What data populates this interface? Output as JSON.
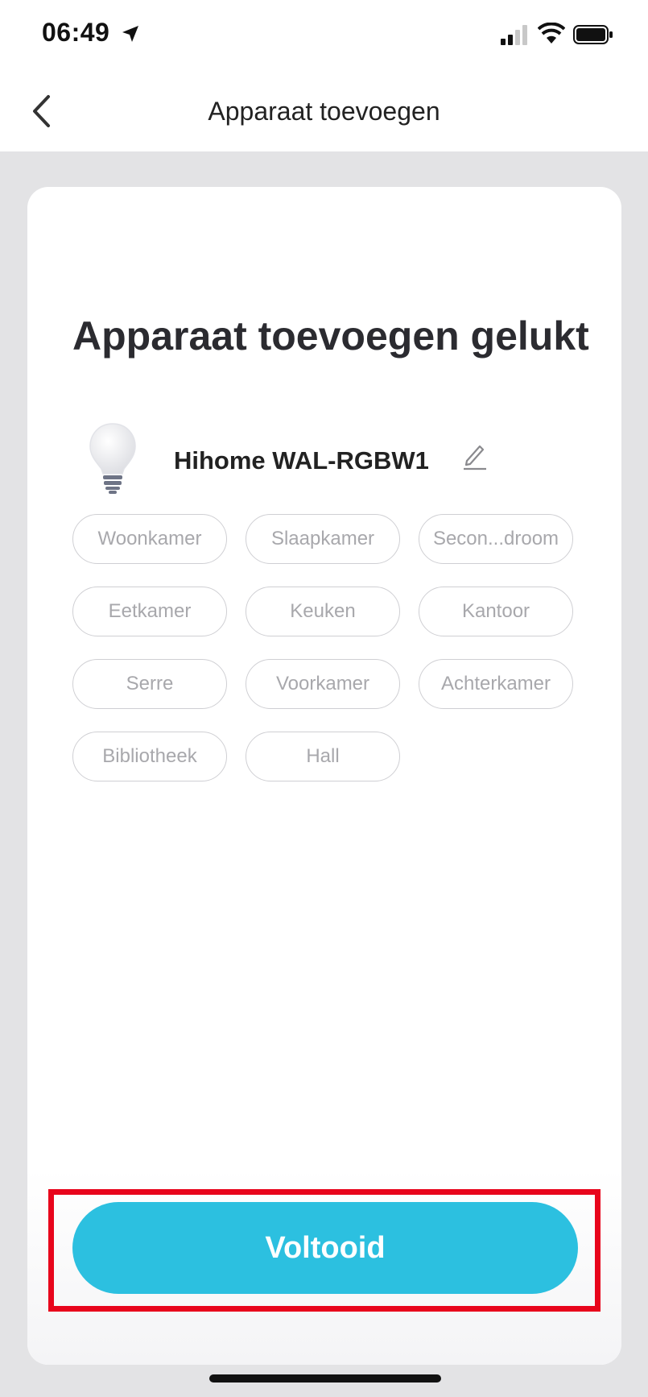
{
  "status_bar": {
    "time": "06:49"
  },
  "nav": {
    "title": "Apparaat toevoegen"
  },
  "main": {
    "heading": "Apparaat toevoegen gelukt",
    "device_name": "Hihome WAL-RGBW1",
    "rooms": [
      "Woonkamer",
      "Slaapkamer",
      "Secon...droom",
      "Eetkamer",
      "Keuken",
      "Kantoor",
      "Serre",
      "Voorkamer",
      "Achterkamer",
      "Bibliotheek",
      "Hall"
    ],
    "done_label": "Voltooid"
  },
  "colors": {
    "accent": "#2cc0e0",
    "highlight": "#e8051c",
    "background": "#e3e3e5"
  },
  "icons": {
    "back": "chevron-left-icon",
    "device": "light-bulb-icon",
    "edit": "pencil-icon"
  }
}
